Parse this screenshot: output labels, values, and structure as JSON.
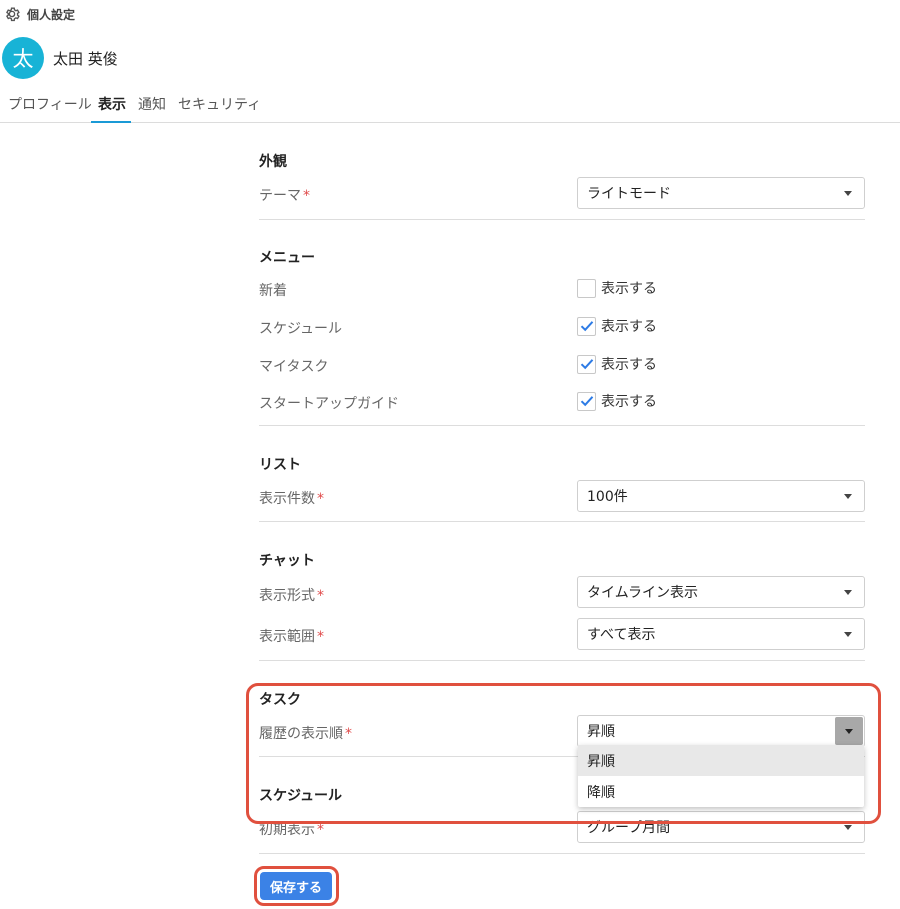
{
  "header": {
    "title": "個人設定",
    "icon": "gear-icon"
  },
  "user": {
    "avatar_text": "太",
    "name": "太田 英俊",
    "avatar_color": "#18b3d6"
  },
  "tabs": [
    {
      "label": "プロフィール",
      "active": false
    },
    {
      "label": "表示",
      "active": true
    },
    {
      "label": "通知",
      "active": false
    },
    {
      "label": "セキュリティ",
      "active": false
    }
  ],
  "appearance": {
    "title": "外観",
    "theme_label": "テーマ",
    "theme_value": "ライトモード"
  },
  "menu": {
    "title": "メニュー",
    "items": [
      {
        "label": "新着",
        "check_label": "表示する",
        "checked": false
      },
      {
        "label": "スケジュール",
        "check_label": "表示する",
        "checked": true
      },
      {
        "label": "マイタスク",
        "check_label": "表示する",
        "checked": true
      },
      {
        "label": "スタートアップガイド",
        "check_label": "表示する",
        "checked": true
      }
    ]
  },
  "list": {
    "title": "リスト",
    "count_label": "表示件数",
    "count_value": "100件"
  },
  "chat": {
    "title": "チャット",
    "format_label": "表示形式",
    "format_value": "タイムライン表示",
    "range_label": "表示範囲",
    "range_value": "すべて表示"
  },
  "task": {
    "title": "タスク",
    "history_label": "履歴の表示順",
    "history_value": "昇順",
    "options": [
      "昇順",
      "降順"
    ]
  },
  "schedule": {
    "title": "スケジュール",
    "initial_label": "初期表示",
    "initial_value": "グループ月間"
  },
  "required_mark": "*",
  "save_label": "保存する",
  "colors": {
    "accent": "#3b82e6",
    "highlight": "#e0503e",
    "required": "#e04a4a",
    "tab_underline": "#1a9ad6"
  }
}
